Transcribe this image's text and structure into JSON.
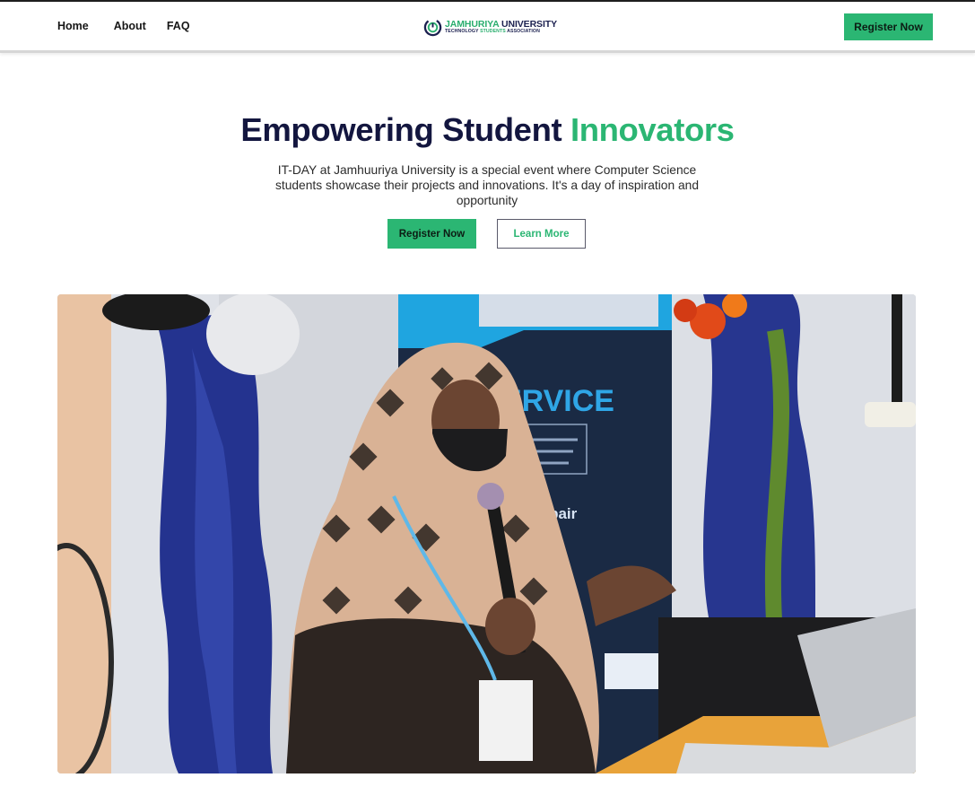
{
  "nav": {
    "links": [
      {
        "label": "Home"
      },
      {
        "label": "About"
      },
      {
        "label": "FAQ"
      }
    ],
    "register_label": "Register Now"
  },
  "logo": {
    "line1_part1": "JAMHURIYA",
    "line1_part2": " UNIVERSITY",
    "line2_part1": "TECHNOLOGY ",
    "line2_part2": "STUDENTS",
    "line2_part3": " ASSOCIATION"
  },
  "hero": {
    "title_main": "Empowering Student ",
    "title_accent": "Innovators",
    "description": "IT-DAY at Jamhuuriya University is a special event where Computer Science students showcase their projects and innovations. It's a day of inspiration and opportunity",
    "register_label": "Register Now",
    "learn_more_label": "Learn More"
  },
  "photo": {
    "banner_text": "ERVICE",
    "banner_subtext": "r Repair"
  },
  "colors": {
    "accent": "#2bb673",
    "navy": "#13163f"
  }
}
